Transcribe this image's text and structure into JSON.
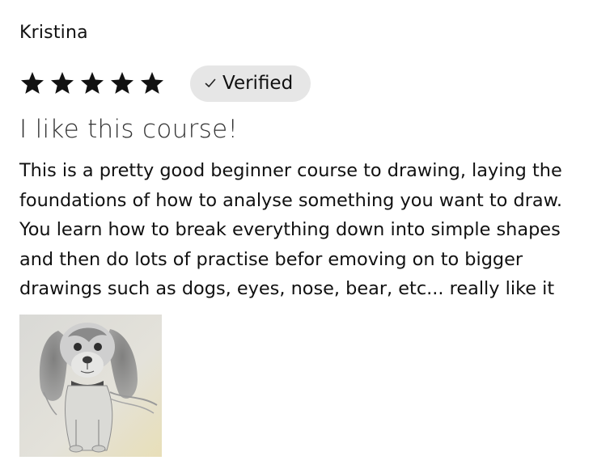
{
  "review": {
    "author": "Kristina",
    "rating": 5,
    "rating_max": 5,
    "badge_label": "Verified",
    "badge_icon": "check-icon",
    "star_icon": "star-icon",
    "star_color": "#111111",
    "badge_bg": "#e6e6e6",
    "headline": "I like this course!",
    "body_lines": [
      "This is a pretty good beginner course to drawing, laying the",
      "foundations of how to analyse something you want to draw.",
      "You learn how to break everything down into simple shapes",
      "and then do lots of practise befor emoving on to bigger",
      "drawings such as dogs, eyes, nose, bear, etc... really like it"
    ],
    "photo_subject": "pencil drawing of a dog"
  }
}
